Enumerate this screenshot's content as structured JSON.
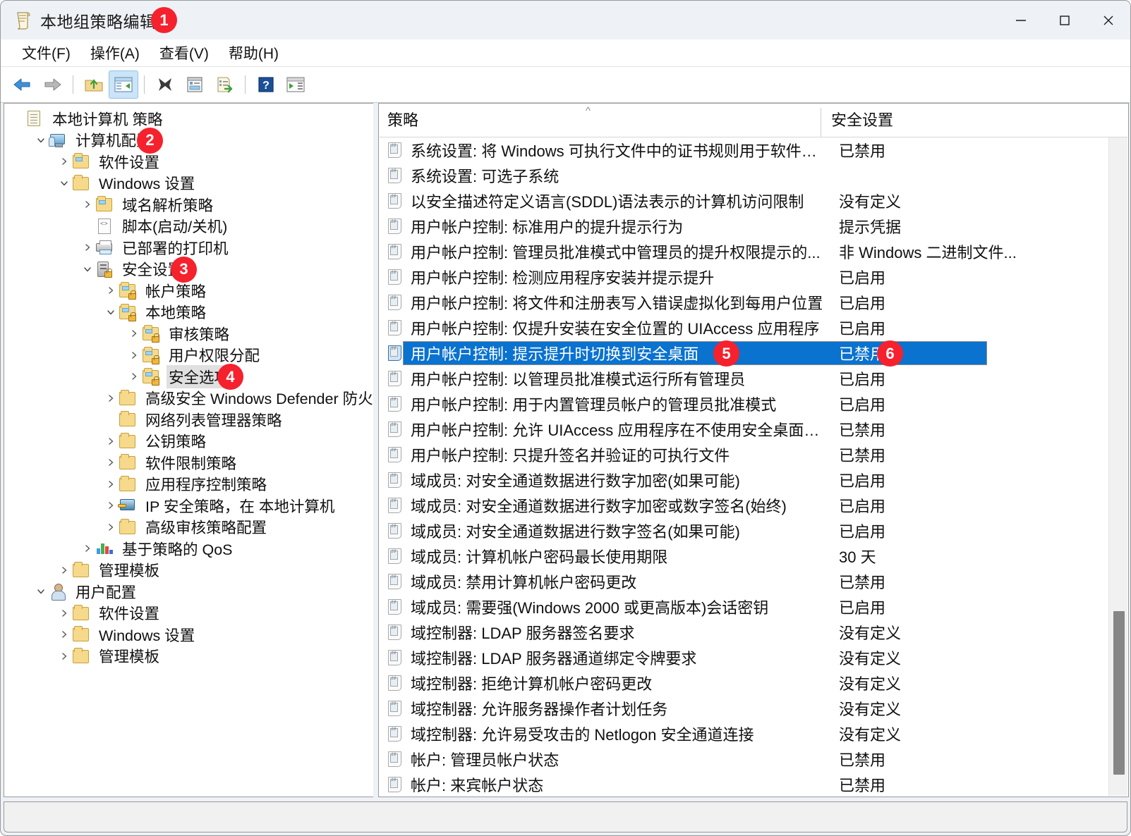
{
  "window": {
    "title": "本地组策略编辑器",
    "icon": "policy-document-icon",
    "controls": {
      "minimize": "−",
      "maximize": "□",
      "close": "✕"
    }
  },
  "menubar": {
    "items": [
      {
        "label": "文件(F)",
        "name": "menu-file"
      },
      {
        "label": "操作(A)",
        "name": "menu-action"
      },
      {
        "label": "查看(V)",
        "name": "menu-view"
      },
      {
        "label": "帮助(H)",
        "name": "menu-help"
      }
    ]
  },
  "toolbar": {
    "buttons": [
      {
        "name": "back-icon",
        "label": "后退"
      },
      {
        "name": "forward-icon",
        "label": "前进"
      },
      {
        "name": "up-folder-icon",
        "label": "向上一级"
      },
      {
        "name": "show-hide-tree-icon",
        "label": "显示/隐藏控制台树",
        "active": true
      },
      {
        "name": "delete-icon",
        "label": "删除"
      },
      {
        "name": "properties-icon",
        "label": "属性"
      },
      {
        "name": "export-list-icon",
        "label": "导出列表"
      },
      {
        "name": "help-icon",
        "label": "帮助"
      },
      {
        "name": "show-action-pane-icon",
        "label": "显示/隐藏操作窗格"
      }
    ]
  },
  "tree": {
    "nodes": [
      {
        "label": "本地计算机 策略",
        "indent": 0,
        "chevron": "none",
        "icon": "policy-document-icon",
        "selected": false
      },
      {
        "label": "计算机配置",
        "indent": 1,
        "chevron": "expanded",
        "icon": "computer-config-icon",
        "selected": false,
        "badge": "2"
      },
      {
        "label": "软件设置",
        "indent": 2,
        "chevron": "collapsed",
        "icon": "folder-icon",
        "selected": false
      },
      {
        "label": "Windows 设置",
        "indent": 2,
        "chevron": "expanded",
        "icon": "folder-plain-icon",
        "selected": false
      },
      {
        "label": "域名解析策略",
        "indent": 3,
        "chevron": "collapsed",
        "icon": "folder-icon",
        "selected": false
      },
      {
        "label": "脚本(启动/关机)",
        "indent": 3,
        "chevron": "none",
        "icon": "script-icon",
        "selected": false
      },
      {
        "label": "已部署的打印机",
        "indent": 3,
        "chevron": "collapsed",
        "icon": "printer-icon",
        "selected": false
      },
      {
        "label": "安全设置",
        "indent": 3,
        "chevron": "expanded",
        "icon": "server-lock-icon",
        "selected": false,
        "badge": "3"
      },
      {
        "label": "帐户策略",
        "indent": 4,
        "chevron": "collapsed",
        "icon": "folder-lock-icon",
        "selected": false
      },
      {
        "label": "本地策略",
        "indent": 4,
        "chevron": "expanded",
        "icon": "folder-lock-icon",
        "selected": false
      },
      {
        "label": "审核策略",
        "indent": 5,
        "chevron": "collapsed",
        "icon": "folder-lock-icon",
        "selected": false
      },
      {
        "label": "用户权限分配",
        "indent": 5,
        "chevron": "collapsed",
        "icon": "folder-lock-icon",
        "selected": false
      },
      {
        "label": "安全选项",
        "indent": 5,
        "chevron": "collapsed",
        "icon": "folder-lock-icon",
        "selected": true,
        "badge": "4"
      },
      {
        "label": "高级安全 Windows Defender 防火墙",
        "indent": 4,
        "chevron": "collapsed",
        "icon": "folder-plain-icon",
        "selected": false
      },
      {
        "label": "网络列表管理器策略",
        "indent": 4,
        "chevron": "none",
        "icon": "folder-plain-icon",
        "selected": false
      },
      {
        "label": "公钥策略",
        "indent": 4,
        "chevron": "collapsed",
        "icon": "folder-plain-icon",
        "selected": false
      },
      {
        "label": "软件限制策略",
        "indent": 4,
        "chevron": "collapsed",
        "icon": "folder-plain-icon",
        "selected": false
      },
      {
        "label": "应用程序控制策略",
        "indent": 4,
        "chevron": "collapsed",
        "icon": "folder-plain-icon",
        "selected": false
      },
      {
        "label": "IP 安全策略，在 本地计算机",
        "indent": 4,
        "chevron": "collapsed",
        "icon": "ipsec-icon",
        "selected": false
      },
      {
        "label": "高级审核策略配置",
        "indent": 4,
        "chevron": "collapsed",
        "icon": "folder-plain-icon",
        "selected": false
      },
      {
        "label": "基于策略的 QoS",
        "indent": 3,
        "chevron": "collapsed",
        "icon": "qos-chart-icon",
        "selected": false
      },
      {
        "label": "管理模板",
        "indent": 2,
        "chevron": "collapsed",
        "icon": "folder-plain-icon",
        "selected": false
      },
      {
        "label": "用户配置",
        "indent": 1,
        "chevron": "expanded",
        "icon": "user-config-icon",
        "selected": false
      },
      {
        "label": "软件设置",
        "indent": 2,
        "chevron": "collapsed",
        "icon": "folder-plain-icon",
        "selected": false
      },
      {
        "label": "Windows 设置",
        "indent": 2,
        "chevron": "collapsed",
        "icon": "folder-plain-icon",
        "selected": false
      },
      {
        "label": "管理模板",
        "indent": 2,
        "chevron": "collapsed",
        "icon": "folder-plain-icon",
        "selected": false
      }
    ]
  },
  "list": {
    "columns": [
      "策略",
      "安全设置"
    ],
    "sort": {
      "column": "策略",
      "direction": "ascending",
      "glyph": "^"
    },
    "rows": [
      {
        "policy": "系统设置: 将 Windows 可执行文件中的证书规则用于软件限...",
        "setting": "已禁用",
        "selected": false
      },
      {
        "policy": "系统设置: 可选子系统",
        "setting": "",
        "selected": false
      },
      {
        "policy": "以安全描述符定义语言(SDDL)语法表示的计算机访问限制",
        "setting": "没有定义",
        "selected": false
      },
      {
        "policy": "用户帐户控制: 标准用户的提升提示行为",
        "setting": "提示凭据",
        "selected": false
      },
      {
        "policy": "用户帐户控制: 管理员批准模式中管理员的提升权限提示的...",
        "setting": "非 Windows 二进制文件...",
        "selected": false
      },
      {
        "policy": "用户帐户控制: 检测应用程序安装并提示提升",
        "setting": "已启用",
        "selected": false
      },
      {
        "policy": "用户帐户控制: 将文件和注册表写入错误虚拟化到每用户位置",
        "setting": "已启用",
        "selected": false
      },
      {
        "policy": "用户帐户控制: 仅提升安装在安全位置的 UIAccess 应用程序",
        "setting": "已启用",
        "selected": false
      },
      {
        "policy": "用户帐户控制: 提示提升时切换到安全桌面",
        "setting": "已禁用",
        "selected": true,
        "badge_policy": "5",
        "badge_setting": "6"
      },
      {
        "policy": "用户帐户控制: 以管理员批准模式运行所有管理员",
        "setting": "已启用",
        "selected": false
      },
      {
        "policy": "用户帐户控制: 用于内置管理员帐户的管理员批准模式",
        "setting": "已启用",
        "selected": false
      },
      {
        "policy": "用户帐户控制: 允许 UIAccess 应用程序在不使用安全桌面的...",
        "setting": "已禁用",
        "selected": false
      },
      {
        "policy": "用户帐户控制: 只提升签名并验证的可执行文件",
        "setting": "已禁用",
        "selected": false
      },
      {
        "policy": "域成员: 对安全通道数据进行数字加密(如果可能)",
        "setting": "已启用",
        "selected": false
      },
      {
        "policy": "域成员: 对安全通道数据进行数字加密或数字签名(始终)",
        "setting": "已启用",
        "selected": false
      },
      {
        "policy": "域成员: 对安全通道数据进行数字签名(如果可能)",
        "setting": "已启用",
        "selected": false
      },
      {
        "policy": "域成员: 计算机帐户密码最长使用期限",
        "setting": "30 天",
        "selected": false
      },
      {
        "policy": "域成员: 禁用计算机帐户密码更改",
        "setting": "已禁用",
        "selected": false
      },
      {
        "policy": "域成员: 需要强(Windows 2000 或更高版本)会话密钥",
        "setting": "已启用",
        "selected": false
      },
      {
        "policy": "域控制器: LDAP 服务器签名要求",
        "setting": "没有定义",
        "selected": false
      },
      {
        "policy": "域控制器: LDAP 服务器通道绑定令牌要求",
        "setting": "没有定义",
        "selected": false
      },
      {
        "policy": "域控制器: 拒绝计算机帐户密码更改",
        "setting": "没有定义",
        "selected": false
      },
      {
        "policy": "域控制器: 允许服务器操作者计划任务",
        "setting": "没有定义",
        "selected": false
      },
      {
        "policy": "域控制器: 允许易受攻击的 Netlogon 安全通道连接",
        "setting": "没有定义",
        "selected": false
      },
      {
        "policy": "帐户: 管理员帐户状态",
        "setting": "已禁用",
        "selected": false
      },
      {
        "policy": "帐户: 来宾帐户状态",
        "setting": "已禁用",
        "selected": false
      }
    ]
  },
  "statusbar": {
    "text": ""
  },
  "colors": {
    "selection_blue": "#0a72cf",
    "badge_red": "#f5212d",
    "titlebar_bg": "#eef1f5",
    "toolbar_active": "#cce4f7"
  }
}
